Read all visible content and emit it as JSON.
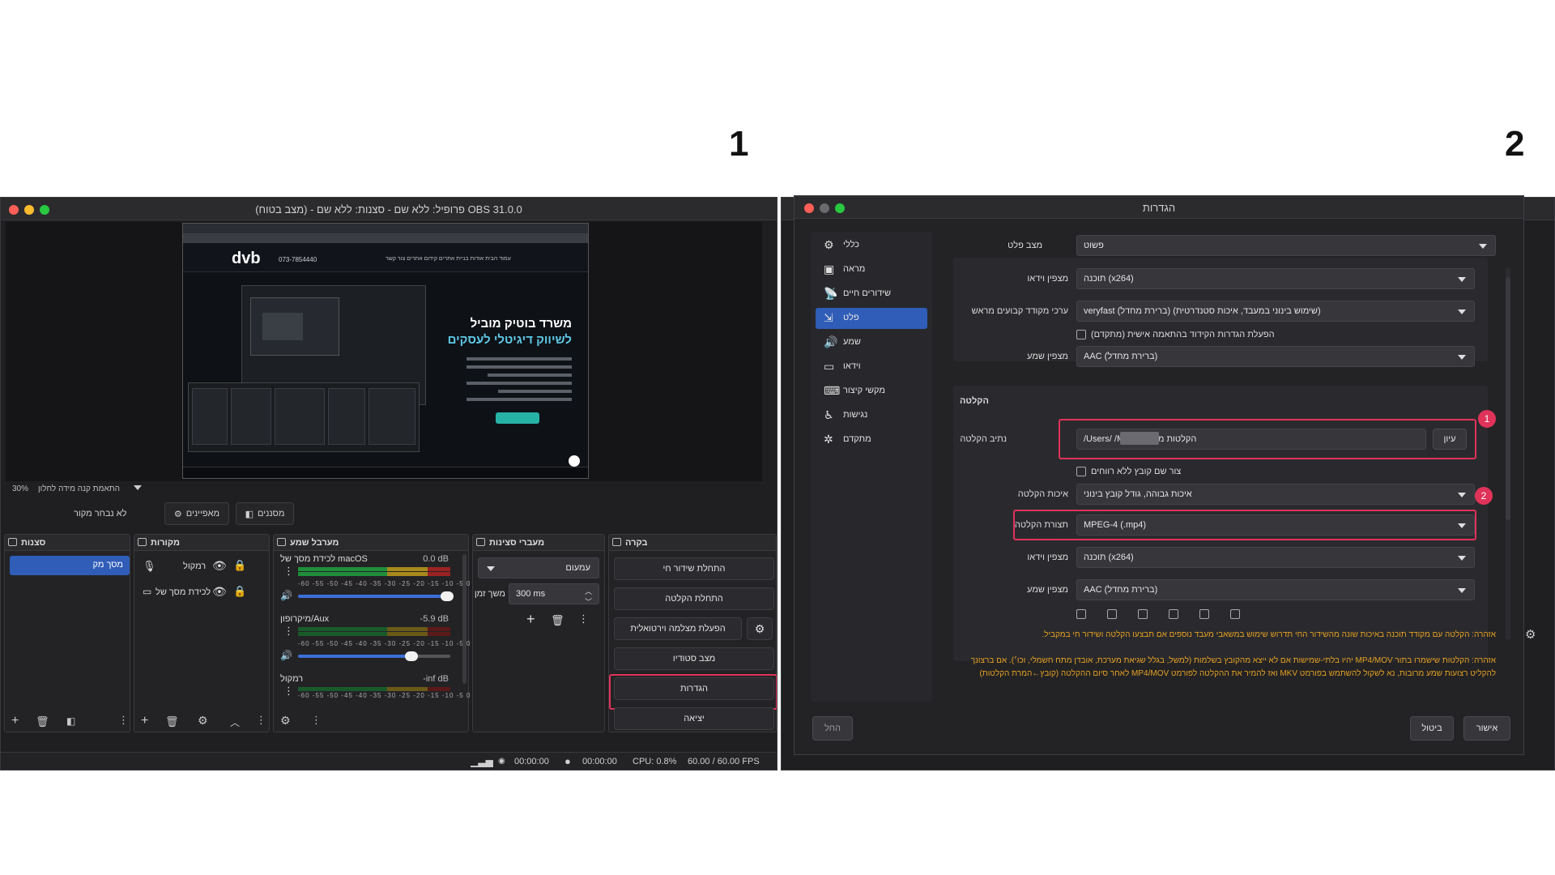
{
  "markers": {
    "left": "1",
    "right": "2"
  },
  "obs": {
    "title": "פרופיל: ללא שם - סצנות: ללא שם - (מצב בטוח) OBS 31.0.0",
    "preview": {
      "logo": "dvb",
      "phone": "073-7854440",
      "menu": "עמוד הבית   אודות   בניית אתרים   קידום אתרים   צור קשר",
      "headline1": "משרד בוטיק מוביל",
      "headline2": "לשיווק דיגיטלי לעסקים"
    },
    "zoom": {
      "percent": "30%",
      "label": "התאמת קנה מידה לחלון"
    },
    "source_bar": {
      "no_source": "לא נבחר מקור",
      "properties": "מאפיינים",
      "filters": "מסננים"
    },
    "scenes": {
      "title": "סצנות",
      "items": [
        "מסך מק"
      ]
    },
    "sources": {
      "title": "מקורות",
      "items": [
        "רמקול",
        "לכידת מסך של"
      ]
    },
    "mixer": {
      "title": "מערבל שמע",
      "scale": "-60 -55 -50 -45 -40 -35 -30 -25 -20 -15 -10 -5 0",
      "channels": [
        {
          "name": "לכידת מסך של macOS",
          "db": "0.0 dB"
        },
        {
          "name": "מיקרופון/Aux",
          "db": "-5.9 dB"
        },
        {
          "name": "רמקול",
          "db": "-inf dB"
        }
      ]
    },
    "transitions": {
      "title": "מעברי סצינות",
      "type": "עמעום",
      "duration_label": "משך זמן",
      "duration": "300 ms"
    },
    "controls": {
      "title": "בקרה",
      "buttons": [
        "התחלת שידור חי",
        "התחלת הקלטה",
        "הפעלת מצלמה וירטואלית",
        "מצב סטודיו",
        "הגדרות",
        "יציאה"
      ]
    },
    "status": {
      "stream_time": "00:00:00",
      "rec_time": "00:00:00",
      "cpu": "CPU: 0.8%",
      "fps": "60.00 / 60.00 FPS"
    }
  },
  "settings": {
    "title": "הגדרות",
    "nav": [
      "כללי",
      "מראה",
      "שידורים חיים",
      "פלט",
      "שמע",
      "וידאו",
      "מקשי קיצור",
      "נגישות",
      "מתקדם"
    ],
    "output_mode": {
      "label": "מצב פלט",
      "value": "פשוט"
    },
    "streaming": {
      "video_encoder_label": "מצפין וידאו",
      "video_encoder": "תוכנה (x264)",
      "preset_label": "ערכי מקודד קבועים מראש",
      "preset": "veryfast (ברירת מחדל) (שימוש בינוני במעבד, איכות סטנדרטית)",
      "custom_check": "הפעלת הגדרות הקידוד בהתאמה אישית (מתקדם)",
      "audio_encoder_label": "מצפין שמע",
      "audio_encoder": "AAC (ברירת מחדל)"
    },
    "recording": {
      "section": "הקלטה",
      "path_label": "נתיב הקלטה",
      "path": "/Users/        /Movies/הקלטות מסך",
      "browse": "עיון",
      "no_spaces": "צור שם קובץ ללא רווחים",
      "quality_label": "איכות הקלטה",
      "quality": "איכות גבוהה, גודל קובץ בינוני",
      "format_label": "תצורת הקלטה",
      "format": "MPEG-4 (.mp4)",
      "video_encoder_label": "מצפין וידאו",
      "video_encoder": "תוכנה (x264)",
      "audio_encoder_label": "מצפין שמע",
      "audio_encoder": "AAC (ברירת מחדל)"
    },
    "badges": [
      "1",
      "2"
    ],
    "warning1": "אזהרה: הקלטה עם מקודד תוכנה באיכות שונה מהשידור החי תדרוש שימוש במשאבי מעבד נוספים אם תבצעו הקלטה ושידור חי במקביל.",
    "warning2": "אזהרה: הקלטות שישמרו בתור MP4/MOV יהיו בלתי-שמישות אם לא ייצא מהקובץ בשלמות (למשל, בגלל שגיאת מערכת, אובדן מתח חשמלי, וכו׳). אם ברצונך להקליט רצועות שמע מרובות, נא לשקול להשתמש בפורמט MKV ואז להמיר את ההקלטה לפורמט MP4/MOV לאחר סיום ההקלטה (קובץ←המרת הקלטות)",
    "buttons": {
      "apply": "החל",
      "cancel": "ביטול",
      "ok": "אישור"
    }
  }
}
